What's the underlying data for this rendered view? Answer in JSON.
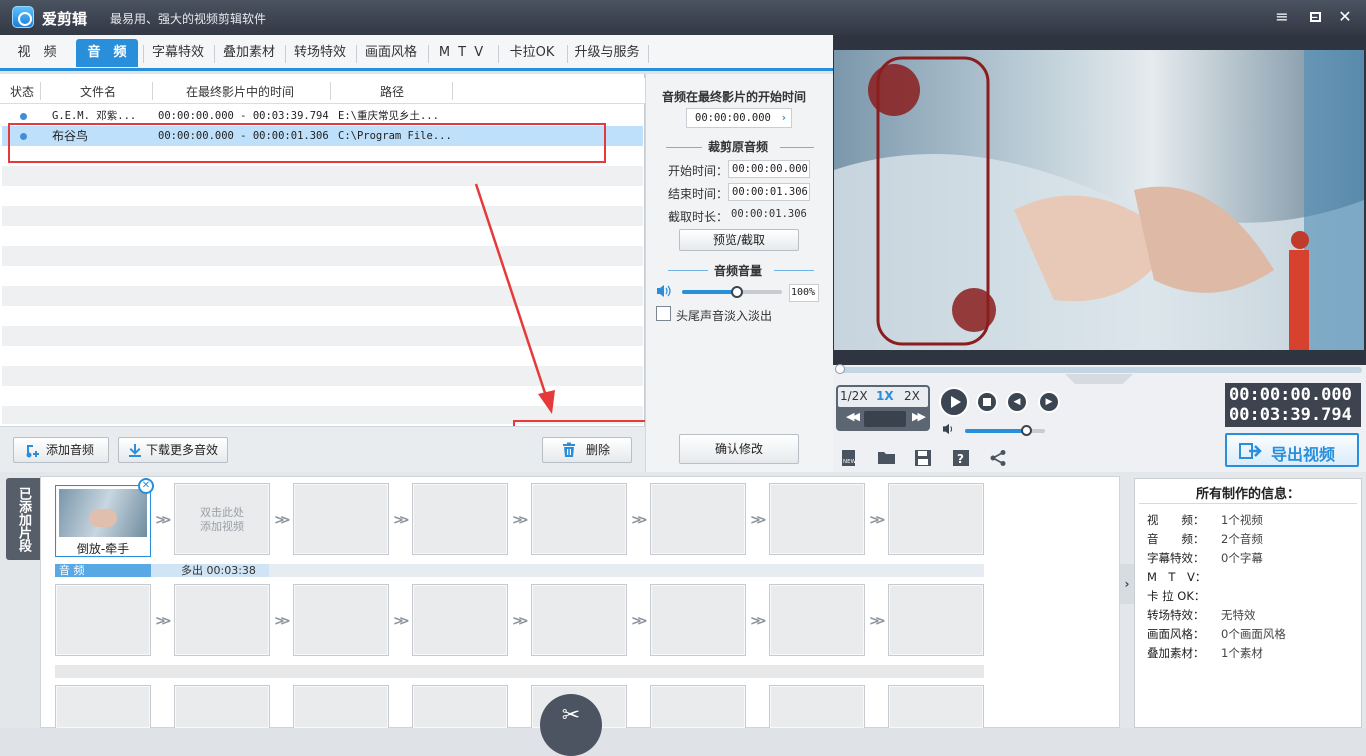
{
  "app": {
    "name": "爱剪辑",
    "slogan": "最易用、强大的视频剪辑软件"
  },
  "window_controls": [
    "menu-icon",
    "minimize-icon",
    "maximize-icon",
    "close-icon"
  ],
  "tabs": [
    {
      "label": "视　频",
      "active": false
    },
    {
      "label": "音　频",
      "active": true
    },
    {
      "label": "字幕特效",
      "active": false
    },
    {
      "label": "叠加素材",
      "active": false
    },
    {
      "label": "转场特效",
      "active": false
    },
    {
      "label": "画面风格",
      "active": false
    },
    {
      "label": "M T V",
      "active": false
    },
    {
      "label": "卡拉OK",
      "active": false
    },
    {
      "label": "升级与服务",
      "active": false
    }
  ],
  "audio_list": {
    "columns": [
      "状态",
      "文件名",
      "在最终影片中的时间",
      "路径"
    ],
    "rows": [
      {
        "name": "G.E.M. 邓紫...",
        "time": "00:00:00.000 - 00:03:39.794",
        "path": "E:\\重庆常见乡土...",
        "selected": false
      },
      {
        "name": "布谷鸟",
        "time": "00:00:00.000 - 00:00:01.306",
        "path": "C:\\Program File...",
        "selected": true
      }
    ]
  },
  "buttons": {
    "add_audio": "添加音频",
    "download_more": "下载更多音效",
    "delete": "删除",
    "confirm": "确认修改",
    "preview_cut": "预览/截取",
    "export": "导出视频"
  },
  "settings": {
    "start_title": "音频在最终影片的开始时间",
    "start_value": "00:00:00.000",
    "crop_title": "裁剪原音频",
    "start_label": "开始时间：",
    "start_time": "00:00:00.000",
    "end_label": "结束时间：",
    "end_time": "00:00:01.306",
    "dur_label": "截取时长：",
    "dur_time": "00:00:01.306",
    "volume_title": "音频音量",
    "volume_value": "100%",
    "volume_level": 0.55,
    "fade_label": "头尾声音淡入淡出"
  },
  "player": {
    "speeds": [
      "1/2X",
      "1X",
      "2X"
    ],
    "active_speed": "1X",
    "time_current": "00:00:00.000",
    "time_total": "00:03:39.794",
    "volume_level": 0.78
  },
  "timeline": {
    "side_label": "已添加片段",
    "clip_caption": "倒放-牵手",
    "empty_hint_1": "双击此处",
    "empty_hint_2": "添加视频",
    "audio_track_label": "音 频",
    "audio_track_text": "多出 00:03:38"
  },
  "info": {
    "title": "所有制作的信息：",
    "rows": [
      {
        "label": "视　　频：",
        "value": "1个视频"
      },
      {
        "label": "音　　频：",
        "value": "2个音频"
      },
      {
        "label": "字幕特效：",
        "value": "0个字幕"
      },
      {
        "label": "M　T　V：",
        "value": ""
      },
      {
        "label": "卡 拉 OK：",
        "value": ""
      },
      {
        "label": "转场特效：",
        "value": "无特效"
      },
      {
        "label": "画面风格：",
        "value": "0个画面风格"
      },
      {
        "label": "叠加素材：",
        "value": "1个素材"
      }
    ]
  },
  "colors": {
    "accent": "#2a8fdb",
    "annotation": "#e63a3a",
    "titlebar": "#3a414d"
  }
}
